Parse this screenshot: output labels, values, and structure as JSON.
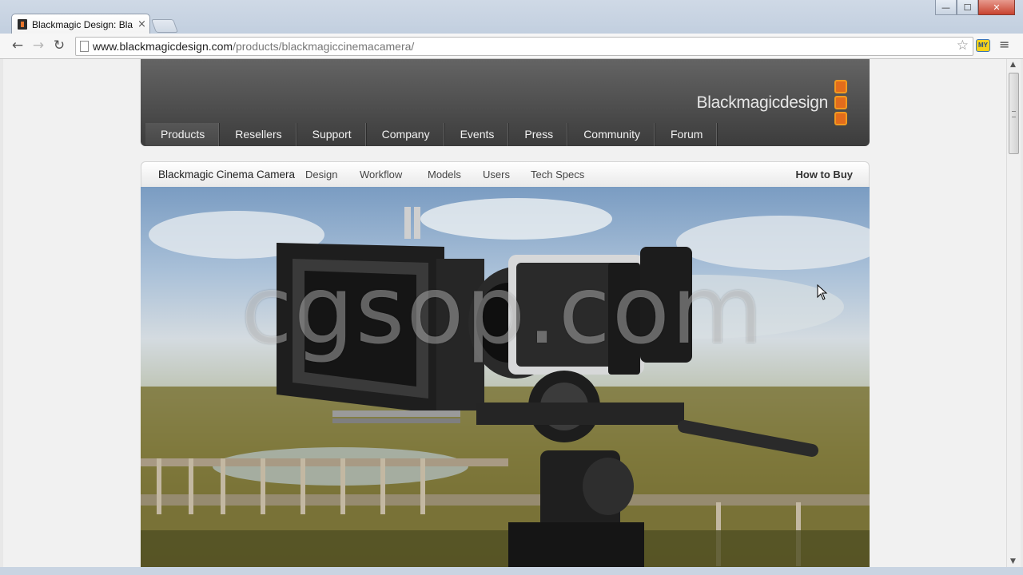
{
  "browser": {
    "tab_title": "Blackmagic Design: Blackmagic Cinema Camera",
    "tab_close": "×",
    "url_host": "www.blackmagicdesign.com",
    "url_path": "/products/blackmagiccinemacamera/",
    "window_controls": {
      "minimize": "—",
      "maximize": "☐",
      "close": "✕"
    },
    "extension_label": "MY",
    "icons": {
      "back": "←",
      "forward": "→",
      "reload": "↻",
      "star": "☆",
      "menu": "≡"
    }
  },
  "site": {
    "logo_text": "Blackmagicdesign",
    "brand_colors": {
      "orange": "#e36c1c",
      "header": "#4e4e4e"
    },
    "main_nav": [
      {
        "label": "Products"
      },
      {
        "label": "Resellers"
      },
      {
        "label": "Support"
      },
      {
        "label": "Company"
      },
      {
        "label": "Events"
      },
      {
        "label": "Press"
      },
      {
        "label": "Community"
      },
      {
        "label": "Forum"
      }
    ],
    "sub_nav": {
      "title": "Blackmagic Cinema Camera",
      "items": [
        {
          "label": "Design"
        },
        {
          "label": "Workflow"
        },
        {
          "label": "Models"
        },
        {
          "label": "Users"
        },
        {
          "label": "Tech Specs"
        }
      ],
      "how_to_buy": "How to Buy"
    },
    "watermark": "cgsop.com"
  }
}
